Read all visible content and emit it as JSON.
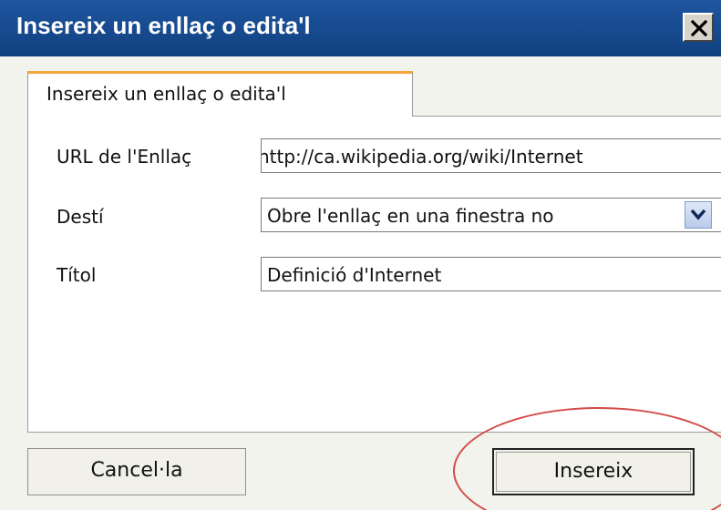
{
  "dialog": {
    "title": "Insereix un enllaç o edita'l",
    "close_icon": "close-icon"
  },
  "tabs": [
    {
      "label": "Insereix un enllaç o edita'l",
      "active": true
    }
  ],
  "form": {
    "url": {
      "label": "URL de l'Enllaç",
      "value": "http://ca.wikipedia.org/wiki/Internet"
    },
    "target": {
      "label": "Destí",
      "value": "Obre l'enllaç en una finestra no",
      "icon": "chevron-down-icon"
    },
    "title": {
      "label": "Títol",
      "value": "Definició d'Internet"
    }
  },
  "buttons": {
    "cancel_label": "Cancel·la",
    "insert_label": "Insereix"
  },
  "colors": {
    "titlebar": "#1a4f96",
    "tab_accent": "#f0a63a",
    "highlight_circle": "#d44b46"
  }
}
